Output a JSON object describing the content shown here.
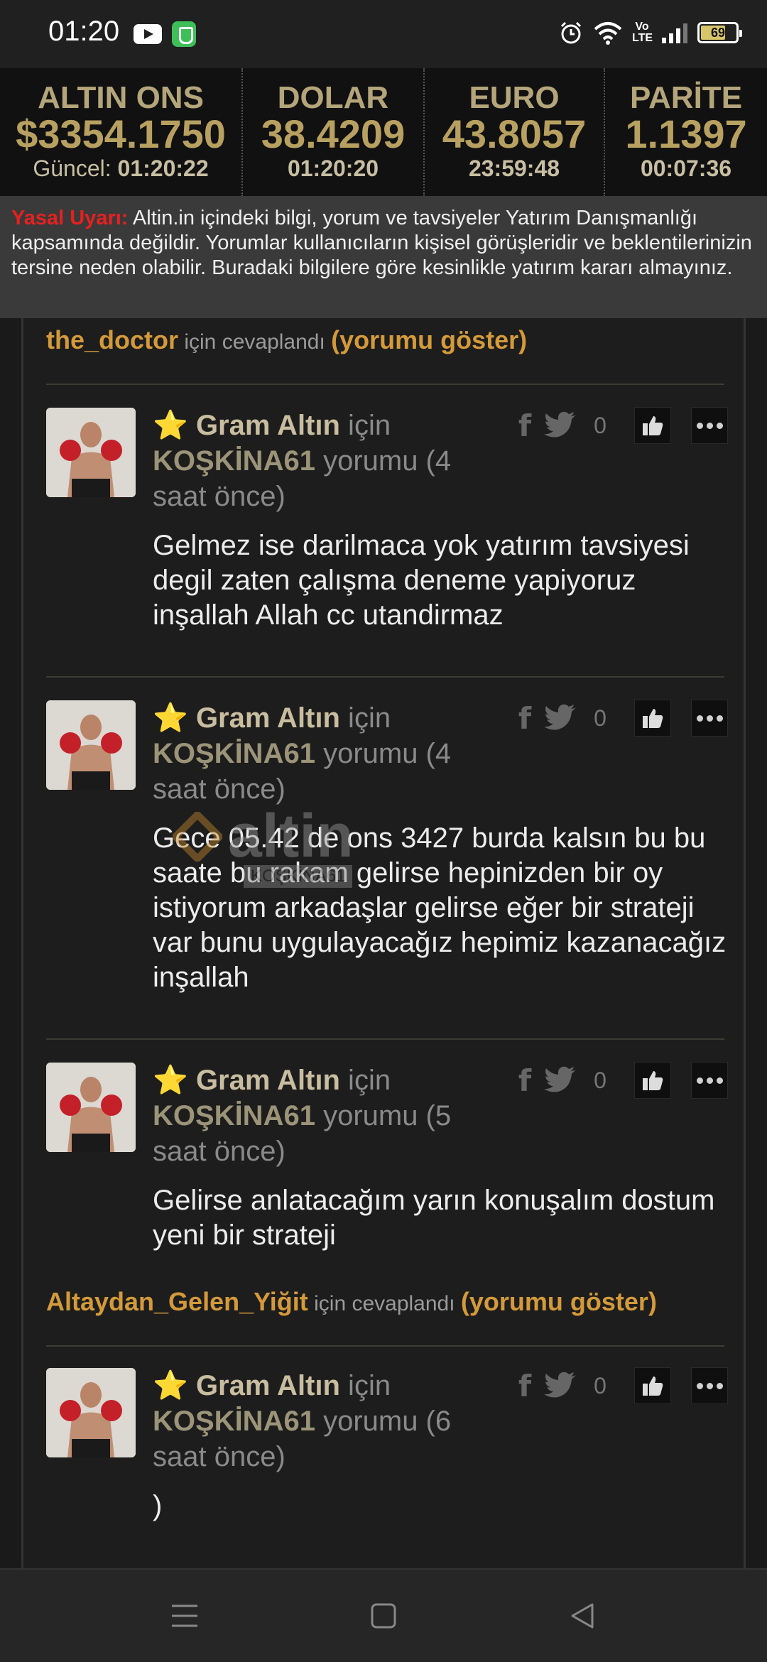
{
  "status_bar": {
    "time": "01:20",
    "battery": "69",
    "volte_top": "Vo",
    "volte_bottom": "LTE",
    "icons": [
      "youtube-icon",
      "shield-icon",
      "alarm-icon",
      "wifi-icon",
      "volte-icon",
      "signal-icon",
      "battery-icon"
    ]
  },
  "ticker": [
    {
      "name": "ALTIN ONS",
      "value": "$3354.1750",
      "time_label": "Güncel:",
      "time": "01:20:22"
    },
    {
      "name": "DOLAR",
      "value": "38.4209",
      "time_label": "",
      "time": "01:20:20"
    },
    {
      "name": "EURO",
      "value": "43.8057",
      "time_label": "",
      "time": "23:59:48"
    },
    {
      "name": "PARİTE",
      "value": "1.1397",
      "time_label": "",
      "time": "00:07:36"
    }
  ],
  "warning": {
    "label": "Yasal Uyarı:",
    "text": " Altin.in içindeki bilgi, yorum ve tavsiyeler Yatırım Danışmanlığı kapsamında değildir. Yorumlar kullanıcıların kişisel görüşleridir ve beklentilerinizin tersine neden olabilir. Buradaki bilgilere göre kesinlikle yatırım kararı almayınız."
  },
  "replies": [
    {
      "user": "the_doctor",
      "mid": " için cevaplandı ",
      "show": "(yorumu göster)"
    },
    {
      "user": "Altaydan_Gelen_Yiğit",
      "mid": " için cevaplandı ",
      "show": "(yorumu göster)"
    }
  ],
  "comments": [
    {
      "symbol": "Gram Altın",
      "for": " için",
      "user": "KOŞKİNA61",
      "meta": " yorumu (4 saat önce)",
      "body": "Gelmez ise darilmaca yok yatırım tavsiyesi degil zaten çalışma deneme yapiyoruz inşallah Allah cc utandirmaz",
      "count": "0"
    },
    {
      "symbol": "Gram Altın",
      "for": " için",
      "user": "KOŞKİNA61",
      "meta": " yorumu (4 saat önce)",
      "body": "Gece 05.42 de ons 3427 burda kalsın bu bu saate bu rakam gelirse hepinizden bir oy istiyorum arkadaşlar gelirse eğer bir strateji var bunu uygulayacağız hepimiz kazanacağız inşallah",
      "count": "0"
    },
    {
      "symbol": "Gram Altın",
      "for": " için",
      "user": "KOŞKİNA61",
      "meta": " yorumu (5 saat önce)",
      "body": "Gelirse anlatacağım yarın konuşalım dostum yeni bir strateji",
      "count": "0"
    },
    {
      "symbol": "Gram Altın",
      "for": " için",
      "user": "KOŞKİNA61",
      "meta": " yorumu (6 saat önce)",
      "body": ")",
      "count": "0"
    }
  ],
  "watermark": {
    "text": "altin",
    "tag": "KOŞKİNA61"
  },
  "colors": {
    "accent": "#d49a3a",
    "gold": "#b8a060",
    "warning_red": "#e62020"
  }
}
